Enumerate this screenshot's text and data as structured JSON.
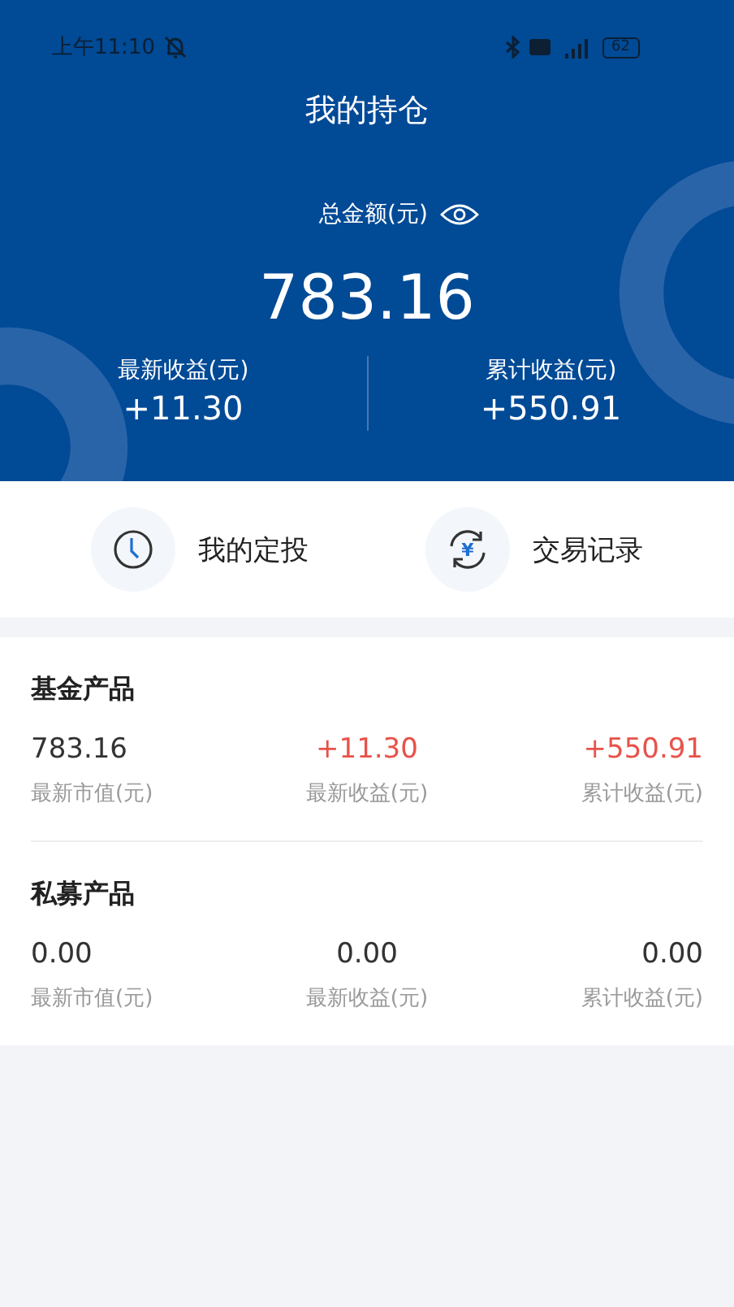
{
  "status_bar": {
    "time": "上午11:10",
    "battery": "62"
  },
  "header": {
    "title": "我的持仓",
    "total_label": "总金额(元)",
    "total": "783.16",
    "stats": [
      {
        "label": "最新收益(元)",
        "value": "+11.30"
      },
      {
        "label": "累计收益(元)",
        "value": "+550.91"
      }
    ]
  },
  "actions": [
    {
      "kind": "clock",
      "label": "我的定投"
    },
    {
      "kind": "exchange",
      "glyph": "¥",
      "label": "交易记录"
    }
  ],
  "products": [
    {
      "name": "基金产品",
      "figures": [
        {
          "value": "783.16",
          "label": "最新市值(元)",
          "color": "#333333"
        },
        {
          "value": "+11.30",
          "label": "最新收益(元)",
          "color": "#e8524a"
        },
        {
          "value": "+550.91",
          "label": "累计收益(元)",
          "color": "#e8524a"
        }
      ]
    },
    {
      "name": "私募产品",
      "figures": [
        {
          "value": "0.00",
          "label": "最新市值(元)",
          "color": "#333333"
        },
        {
          "value": "0.00",
          "label": "最新收益(元)",
          "color": "#333333"
        },
        {
          "value": "0.00",
          "label": "累计收益(元)",
          "color": "#333333"
        }
      ]
    }
  ]
}
